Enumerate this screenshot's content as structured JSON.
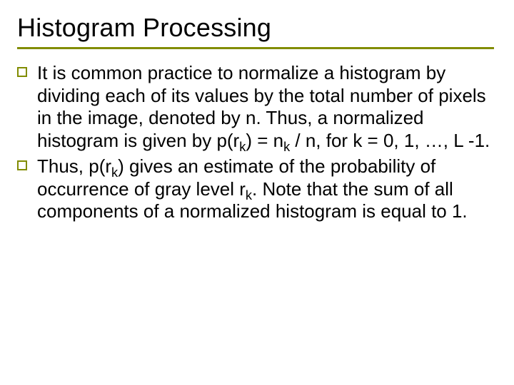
{
  "title": "Histogram Processing",
  "bullets": [
    {
      "segments": [
        {
          "t": "It is common practice to normalize a histogram by dividing each of its values by the total number of pixels in the image, denoted by n. Thus, a normalized histogram is given by p(r"
        },
        {
          "t": "k",
          "sub": true
        },
        {
          "t": ") = n"
        },
        {
          "t": "k",
          "sub": true
        },
        {
          "t": " / n, for k = 0, 1, …, L -1."
        }
      ]
    },
    {
      "segments": [
        {
          "t": "Thus, p(r"
        },
        {
          "t": "k",
          "sub": true
        },
        {
          "t": ") gives an estimate of the probability of occurrence of gray level r"
        },
        {
          "t": "k",
          "sub": true
        },
        {
          "t": ". Note that the sum of all components of a normalized histogram is equal to 1."
        }
      ]
    }
  ],
  "accent_color": "#818c00"
}
